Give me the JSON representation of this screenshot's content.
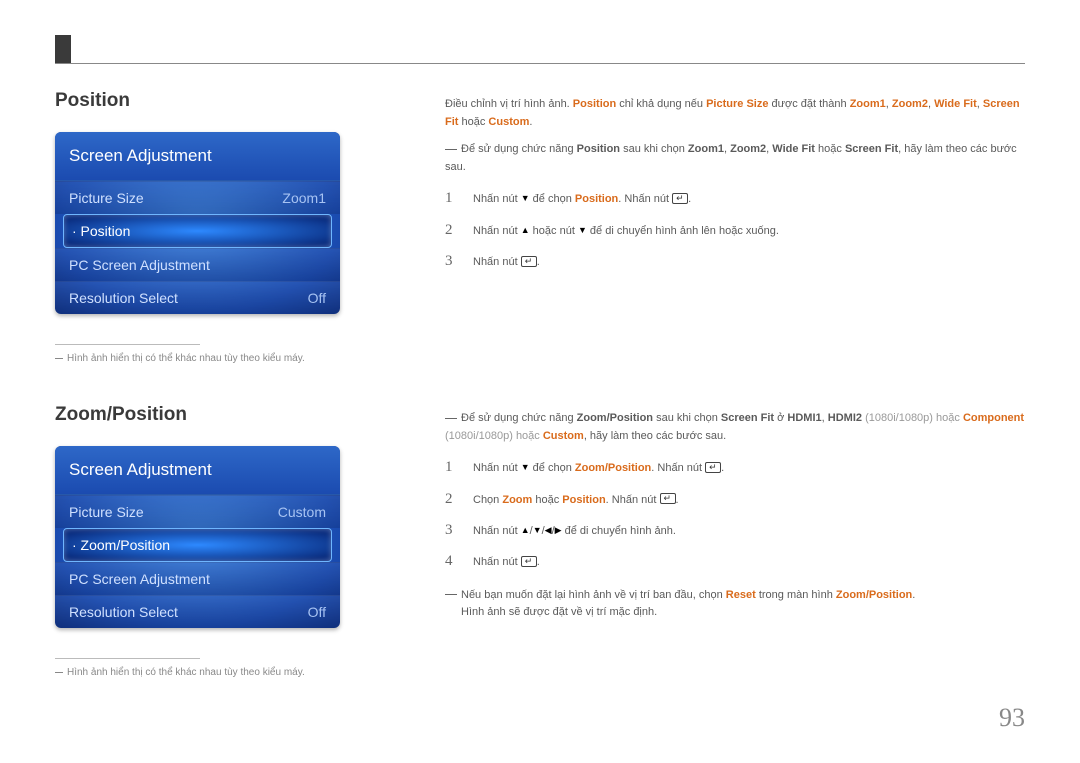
{
  "page_number": "93",
  "section1": {
    "title": "Position",
    "menu": {
      "header": "Screen Adjustment",
      "items": [
        {
          "label": "Picture Size",
          "value": "Zoom1",
          "selected": false
        },
        {
          "label": "· Position",
          "value": "",
          "selected": true
        },
        {
          "label": "PC Screen Adjustment",
          "value": "",
          "selected": false
        },
        {
          "label": "Resolution Select",
          "value": "Off",
          "selected": false
        }
      ]
    },
    "note": "Hình ảnh hiển thị có thể khác nhau tùy theo kiểu máy.",
    "intro": {
      "pre": "Điều chỉnh vị trí hình ảnh. ",
      "hl1": "Position",
      "mid1": " chỉ khả dụng nếu ",
      "hl2": "Picture Size",
      "mid2": " được đặt thành ",
      "hl3": "Zoom1",
      "c1": ", ",
      "hl4": "Zoom2",
      "c2": ", ",
      "hl5": "Wide Fit",
      "c3": ", ",
      "hl6": "Screen Fit",
      "mid3": " hoặc ",
      "hl7": "Custom",
      "end": "."
    },
    "dashnote": {
      "pre": "Để sử dụng chức năng ",
      "hl1": "Position",
      "mid1": " sau khi chọn ",
      "hl2": "Zoom1",
      "c1": ", ",
      "hl3": "Zoom2",
      "c2": ", ",
      "hl4": "Wide Fit",
      "mid2": " hoặc ",
      "hl5": "Screen Fit",
      "end": ", hãy làm theo các bước sau."
    },
    "steps": [
      {
        "n": "1",
        "pre": "Nhấn nút ",
        "icon1": "▼",
        "mid1": " để chọn ",
        "hl": "Position",
        "mid2": ". Nhấn nút ",
        "enter": true,
        "post": "."
      },
      {
        "n": "2",
        "pre": "Nhấn nút ",
        "icon1": "▲",
        "mid1": " hoặc nút ",
        "icon2": "▼",
        "post": " để di chuyển hình ảnh lên hoặc xuống."
      },
      {
        "n": "3",
        "pre": "Nhấn nút ",
        "enter": true,
        "post": "."
      }
    ]
  },
  "section2": {
    "title": "Zoom/Position",
    "menu": {
      "header": "Screen Adjustment",
      "items": [
        {
          "label": "Picture Size",
          "value": "Custom",
          "selected": false
        },
        {
          "label": "· Zoom/Position",
          "value": "",
          "selected": true
        },
        {
          "label": "PC Screen Adjustment",
          "value": "",
          "selected": false
        },
        {
          "label": "Resolution Select",
          "value": "Off",
          "selected": false
        }
      ]
    },
    "note": "Hình ảnh hiển thị có thể khác nhau tùy theo kiểu máy.",
    "dashnote": {
      "pre": "Để sử dụng chức năng ",
      "hl1": "Zoom/Position",
      "mid1": " sau khi chọn ",
      "hl2": "Screen Fit",
      "mid2": " ở ",
      "hl3": "HDMI1",
      "c1": ", ",
      "hl4": "HDMI2",
      "muted1": " (1080i/1080p) hoặc ",
      "hl5": "Component",
      "muted2": " (1080i/1080p) hoặc ",
      "hl6": "Custom",
      "end": ", hãy làm theo các bước sau."
    },
    "steps": [
      {
        "n": "1",
        "pre": "Nhấn nút ",
        "icon1": "▼",
        "mid1": " để chọn ",
        "hl": "Zoom/Position",
        "mid2": ". Nhấn nút ",
        "enter": true,
        "post": "."
      },
      {
        "n": "2",
        "pre": "Chọn ",
        "hl": "Zoom",
        "mid1": " hoặc ",
        "hl2": "Position",
        "mid2": ". Nhấn nút ",
        "enter": true,
        "post": "."
      },
      {
        "n": "3",
        "pre": "Nhấn nút ",
        "icons4": true,
        "post": " để di chuyển hình ảnh."
      },
      {
        "n": "4",
        "pre": "Nhấn nút ",
        "enter": true,
        "post": "."
      }
    ],
    "dashnote2": {
      "pre": "Nếu bạn muốn đặt lại hình ảnh về vị trí ban đầu, chọn ",
      "hl1": "Reset",
      "mid": " trong màn hình ",
      "hl2": "Zoom/Position",
      "end1": ".",
      "line2": "Hình ảnh sẽ được đặt về vị trí mặc định."
    }
  }
}
